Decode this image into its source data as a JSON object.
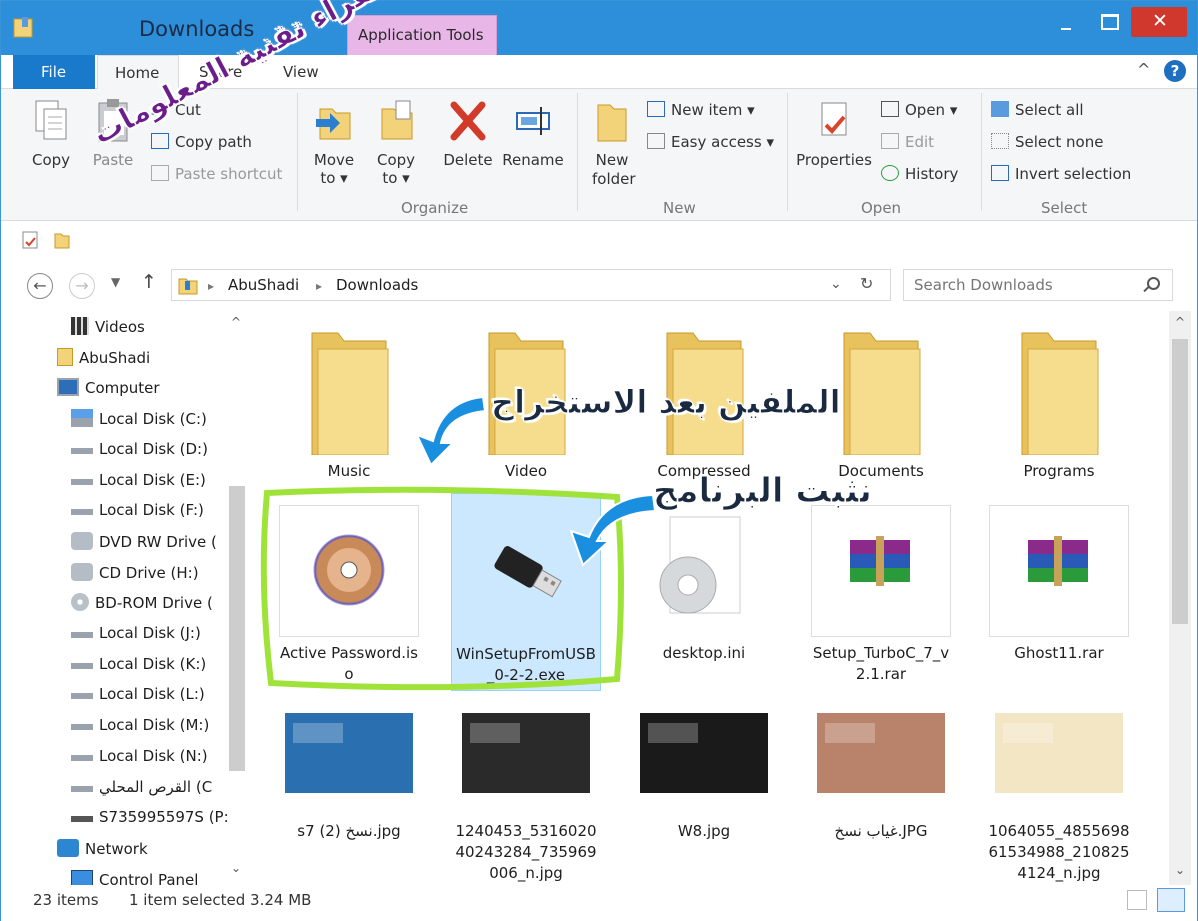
{
  "window": {
    "title": "Downloads",
    "contextual_tab": "Application Tools",
    "close_glyph": "✕"
  },
  "tabs": {
    "file": "File",
    "home": "Home",
    "share": "Share",
    "view": "View",
    "help": "?",
    "collapse": "^"
  },
  "ribbon": {
    "clipboard": {
      "copy": "Copy",
      "paste": "Paste",
      "cut": "Cut",
      "copy_path": "Copy path",
      "paste_shortcut": "Paste shortcut"
    },
    "organize": {
      "label": "Organize",
      "move_to": "Move to ▾",
      "copy_to": "Copy to ▾",
      "delete": "Delete",
      "rename": "Rename"
    },
    "new": {
      "label": "New",
      "new_folder": "New folder",
      "new_item": "New item ▾",
      "easy_access": "Easy access ▾"
    },
    "open": {
      "label": "Open",
      "properties": "Properties",
      "open": "Open ▾",
      "edit": "Edit",
      "history": "History"
    },
    "select": {
      "label": "Select",
      "select_all": "Select all",
      "select_none": "Select none",
      "invert_selection": "Invert selection"
    }
  },
  "address": {
    "crumbs": [
      "AbuShadi",
      "Downloads"
    ],
    "search_placeholder": "Search Downloads"
  },
  "nav_items": [
    {
      "label": "Videos",
      "icon": "videos-icon"
    },
    {
      "label": "AbuShadi",
      "icon": "user-folder-icon"
    },
    {
      "label": "Computer",
      "icon": "computer-icon"
    },
    {
      "label": "Local Disk (C:)",
      "icon": "system-drive-icon"
    },
    {
      "label": "Local Disk (D:)",
      "icon": "drive-icon"
    },
    {
      "label": "Local Disk (E:)",
      "icon": "drive-icon"
    },
    {
      "label": "Local Disk (F:)",
      "icon": "drive-icon"
    },
    {
      "label": "DVD RW Drive (",
      "icon": "optical-drive-icon"
    },
    {
      "label": "CD Drive (H:)",
      "icon": "optical-drive-icon"
    },
    {
      "label": "BD-ROM Drive (",
      "icon": "disc-icon"
    },
    {
      "label": "Local Disk (J:)",
      "icon": "drive-icon"
    },
    {
      "label": "Local Disk (K:)",
      "icon": "drive-icon"
    },
    {
      "label": "Local Disk (L:)",
      "icon": "drive-icon"
    },
    {
      "label": "Local Disk (M:)",
      "icon": "drive-icon"
    },
    {
      "label": "Local Disk (N:)",
      "icon": "drive-icon"
    },
    {
      "label": "القرص المحلي (C",
      "icon": "drive-icon"
    },
    {
      "label": "S735995597S (P:",
      "icon": "network-drive-icon"
    },
    {
      "label": "Network",
      "icon": "network-icon"
    },
    {
      "label": "Control Panel",
      "icon": "control-panel-icon"
    }
  ],
  "files": [
    {
      "name": "Music",
      "kind": "folder"
    },
    {
      "name": "Video",
      "kind": "folder"
    },
    {
      "name": "Compressed",
      "kind": "folder"
    },
    {
      "name": "Documents",
      "kind": "folder"
    },
    {
      "name": "Programs",
      "kind": "folder"
    },
    {
      "name": "Active Password.iso",
      "kind": "disc-image"
    },
    {
      "name": "WinSetupFromUSB_0-2-2.exe",
      "kind": "usb-exe",
      "selected": true
    },
    {
      "name": "desktop.ini",
      "kind": "settings-file"
    },
    {
      "name": "Setup_TurboC_7_v2.1.rar",
      "kind": "rar-archive"
    },
    {
      "name": "Ghost11.rar",
      "kind": "rar-archive"
    },
    {
      "name": "s7 نسخ (2).jpg",
      "kind": "image"
    },
    {
      "name": "1240453_531602040243284_735969006_n.jpg",
      "kind": "image"
    },
    {
      "name": "W8.jpg",
      "kind": "image"
    },
    {
      "name": "غياب نسخ.JPG",
      "kind": "image"
    },
    {
      "name": "1064055_485569861534988_2108254124_n.jpg",
      "kind": "image"
    }
  ],
  "status": {
    "items": "23 items",
    "selected": "1 item selected  3.24 MB"
  },
  "annotations": {
    "watermark": "سفراء تقنية المعلومات",
    "files_after_extract": "الملفين بعد الاستخراج",
    "install_program": "نثبت البرنامج"
  },
  "colors": {
    "titlebar": "#2d8fd9",
    "file_tab": "#1979ca",
    "close": "#d0372d",
    "selection": "#cce8ff",
    "highlight_outline": "#9fe33a"
  }
}
